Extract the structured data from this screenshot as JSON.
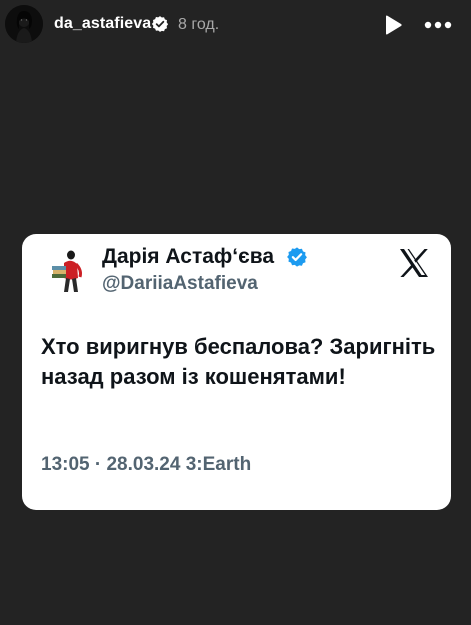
{
  "story": {
    "username": "da_astafieva",
    "time_ago": "8 год.",
    "icons": {
      "avatar": "avatar",
      "verified": "verified-icon",
      "play": "play-icon",
      "more": "more-icon"
    }
  },
  "tweet": {
    "display_name": "Дарія Астаф‘єва",
    "handle": "@DariiaAstafieva",
    "text": "Хто виригнув беспалова? Заригніть назад разом із кошенятами!",
    "meta": "13:05 · 28.03.24 3:Earth",
    "icons": {
      "verified": "verified-icon",
      "platform": "x-logo-icon"
    }
  },
  "colors": {
    "background": "#232323",
    "card": "#ffffff",
    "verified_blue": "#1d9bf0",
    "secondary_text": "#536471"
  }
}
